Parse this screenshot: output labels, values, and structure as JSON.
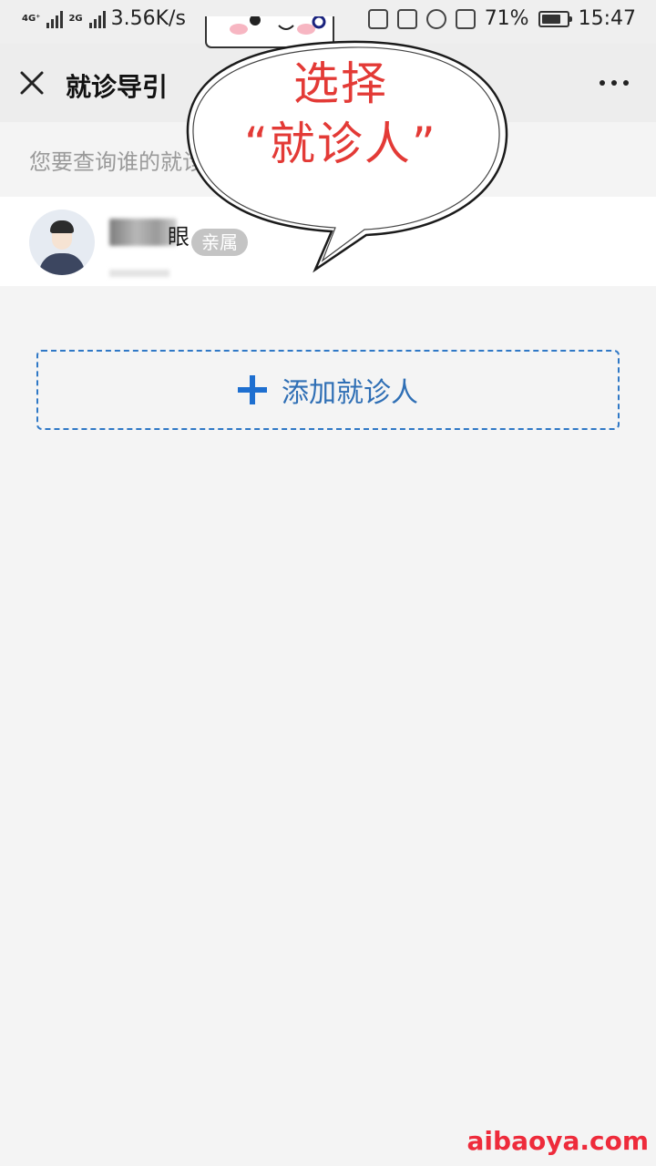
{
  "status_bar": {
    "net1": "4G⁺",
    "net2": "2G",
    "speed": "3.56K/s",
    "battery_pct": "71%",
    "time": "15:47",
    "icons": [
      "hourglass-icon",
      "heart-icon",
      "app-icon",
      "dot-icon",
      "nfc-icon",
      "n-icon",
      "alarm-icon",
      "vibrate-icon",
      "battery-icon"
    ]
  },
  "nav": {
    "title": "就诊导引",
    "close_icon": "close-icon",
    "more_icon": "more-icon"
  },
  "prompt": "您要查询谁的就诊导引?",
  "patient": {
    "name_visible_char": "眼",
    "relation": "亲属"
  },
  "add_button": {
    "label": "添加就诊人"
  },
  "annotation": {
    "line1": "选择",
    "line2": "“就诊人”",
    "color": "#e33a36"
  },
  "watermark": "aibaoya.com",
  "colors": {
    "accent_blue": "#2f78c6",
    "tag_gray": "#c4c4c4",
    "background": "#f4f4f4"
  }
}
